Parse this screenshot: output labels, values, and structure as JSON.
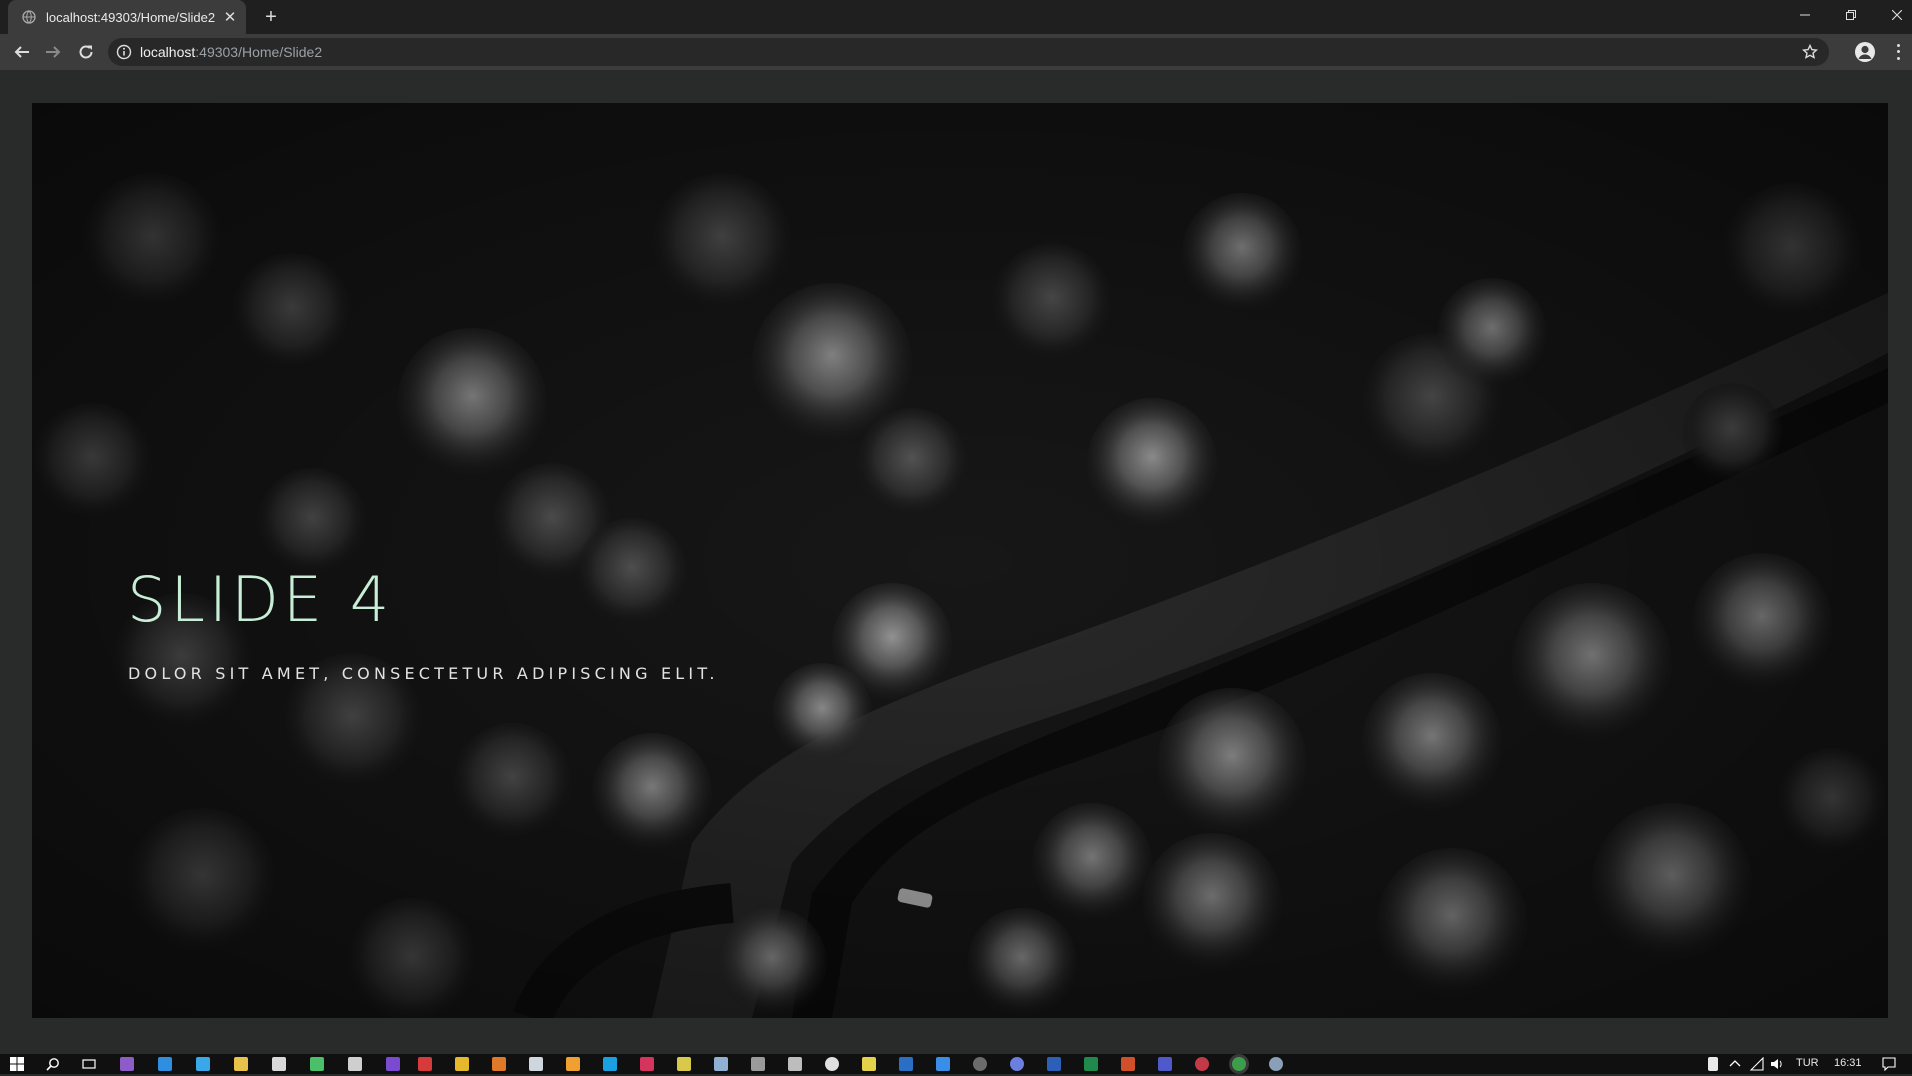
{
  "browser": {
    "tab_title": "localhost:49303/Home/Slide2",
    "url_host": "localhost",
    "url_path": ":49303/Home/Slide2"
  },
  "slide": {
    "title": "SLIDE 4",
    "subtitle": "DOLOR SIT AMET, CONSECTETUR ADIPISCING ELIT."
  },
  "taskbar": {
    "language": "TUR",
    "time": "16:31"
  },
  "colors": {
    "title_accent": "#c9eed8",
    "page_bg": "#282b2a"
  }
}
